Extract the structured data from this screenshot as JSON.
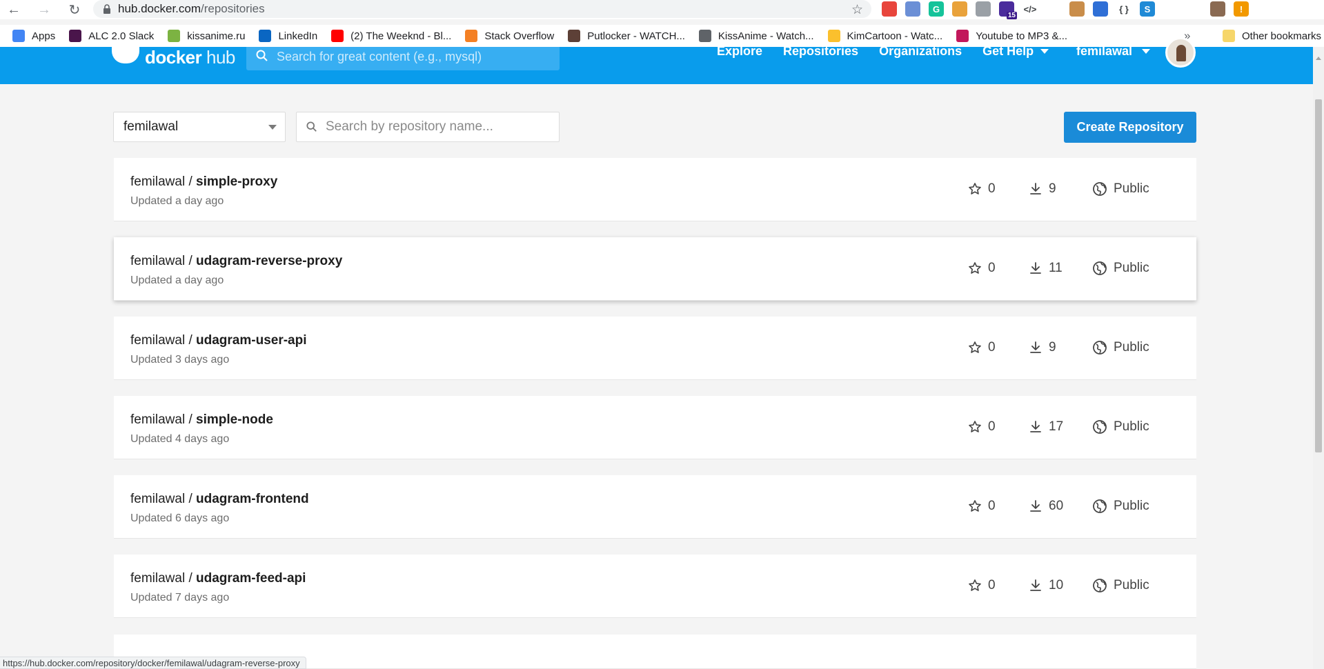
{
  "browser": {
    "url_host": "hub.docker.com",
    "url_path": "/repositories",
    "extensions": [
      {
        "icon": "ext-colorful-icon",
        "color": "#e8453c",
        "text": ""
      },
      {
        "icon": "ext-compass-icon",
        "color": "#6b8fd6",
        "text": ""
      },
      {
        "icon": "grammarly-icon",
        "color": "#15c39a",
        "text": "G"
      },
      {
        "icon": "ext-bowl-icon",
        "color": "#e9a23b",
        "text": ""
      },
      {
        "icon": "ext-gear-icon",
        "color": "#9aa0a6",
        "text": ""
      },
      {
        "icon": "ext-graduation-icon",
        "color": "#4a2b9c",
        "text": "",
        "badge": "15"
      },
      {
        "icon": "ext-code-icon",
        "color": "#ffffff",
        "text": "</>"
      },
      {
        "icon": "ext-card-icon",
        "color": "#ffffff",
        "text": ""
      },
      {
        "icon": "ext-cookie-icon",
        "color": "#c98d4a",
        "text": ""
      },
      {
        "icon": "ext-globe-icon",
        "color": "#2f6fd6",
        "text": ""
      },
      {
        "icon": "ext-json-icon",
        "color": "#ffffff",
        "text": "{ }"
      },
      {
        "icon": "ext-s-icon",
        "color": "#1f8ad6",
        "text": "S"
      },
      {
        "icon": "extensions-puzzle-icon",
        "color": "#ffffff",
        "text": ""
      },
      {
        "icon": "reading-list-icon",
        "color": "#ffffff",
        "text": ""
      },
      {
        "icon": "profile-avatar-icon",
        "color": "#8a6a52",
        "text": ""
      },
      {
        "icon": "update-icon",
        "color": "#f29900",
        "text": "!"
      }
    ]
  },
  "bookmarks": {
    "items": [
      {
        "label": "Apps",
        "icon": "apps-grid-icon",
        "color": "#4285f4"
      },
      {
        "label": "ALC 2.0 Slack",
        "icon": "slack-icon",
        "color": "#4a154b"
      },
      {
        "label": "kissanime.ru",
        "icon": "kissanime-icon",
        "color": "#7cb342"
      },
      {
        "label": "LinkedIn",
        "icon": "linkedin-icon",
        "color": "#0a66c2"
      },
      {
        "label": "(2) The Weeknd - Bl...",
        "icon": "youtube-icon",
        "color": "#ff0000"
      },
      {
        "label": "Stack Overflow",
        "icon": "stackoverflow-icon",
        "color": "#f48024"
      },
      {
        "label": "Putlocker - WATCH...",
        "icon": "putlocker-icon",
        "color": "#5d4037"
      },
      {
        "label": "KissAnime - Watch...",
        "icon": "kissanime-globe-icon",
        "color": "#5f6368"
      },
      {
        "label": "KimCartoon - Watc...",
        "icon": "kimcartoon-icon",
        "color": "#fbc02d"
      },
      {
        "label": "Youtube to MP3 &...",
        "icon": "ytmp3-icon",
        "color": "#c2185b"
      }
    ],
    "more": "»",
    "other": "Other bookmarks"
  },
  "header": {
    "logo_bold": "docker",
    "logo_light": "hub",
    "search_placeholder": "Search for great content (e.g., mysql)",
    "nav": {
      "explore": "Explore",
      "repositories": "Repositories",
      "organizations": "Organizations",
      "help": "Get Help"
    },
    "username": "femilawal"
  },
  "toolbar": {
    "namespace": "femilawal",
    "search_placeholder": "Search by repository name...",
    "create_label": "Create Repository"
  },
  "repos": [
    {
      "namespace": "femilawal /",
      "name": "simple-proxy",
      "updated": "Updated a day ago",
      "stars": "0",
      "pulls": "9",
      "visibility": "Public"
    },
    {
      "namespace": "femilawal /",
      "name": "udagram-reverse-proxy",
      "updated": "Updated a day ago",
      "stars": "0",
      "pulls": "11",
      "visibility": "Public"
    },
    {
      "namespace": "femilawal /",
      "name": "udagram-user-api",
      "updated": "Updated 3 days ago",
      "stars": "0",
      "pulls": "9",
      "visibility": "Public"
    },
    {
      "namespace": "femilawal /",
      "name": "simple-node",
      "updated": "Updated 4 days ago",
      "stars": "0",
      "pulls": "17",
      "visibility": "Public"
    },
    {
      "namespace": "femilawal /",
      "name": "udagram-frontend",
      "updated": "Updated 6 days ago",
      "stars": "0",
      "pulls": "60",
      "visibility": "Public"
    },
    {
      "namespace": "femilawal /",
      "name": "udagram-feed-api",
      "updated": "Updated 7 days ago",
      "stars": "0",
      "pulls": "10",
      "visibility": "Public"
    }
  ],
  "status_url": "https://hub.docker.com/repository/docker/femilawal/udagram-reverse-proxy",
  "colors": {
    "docker_blue": "#099cec",
    "button_blue": "#1a8bd8"
  }
}
